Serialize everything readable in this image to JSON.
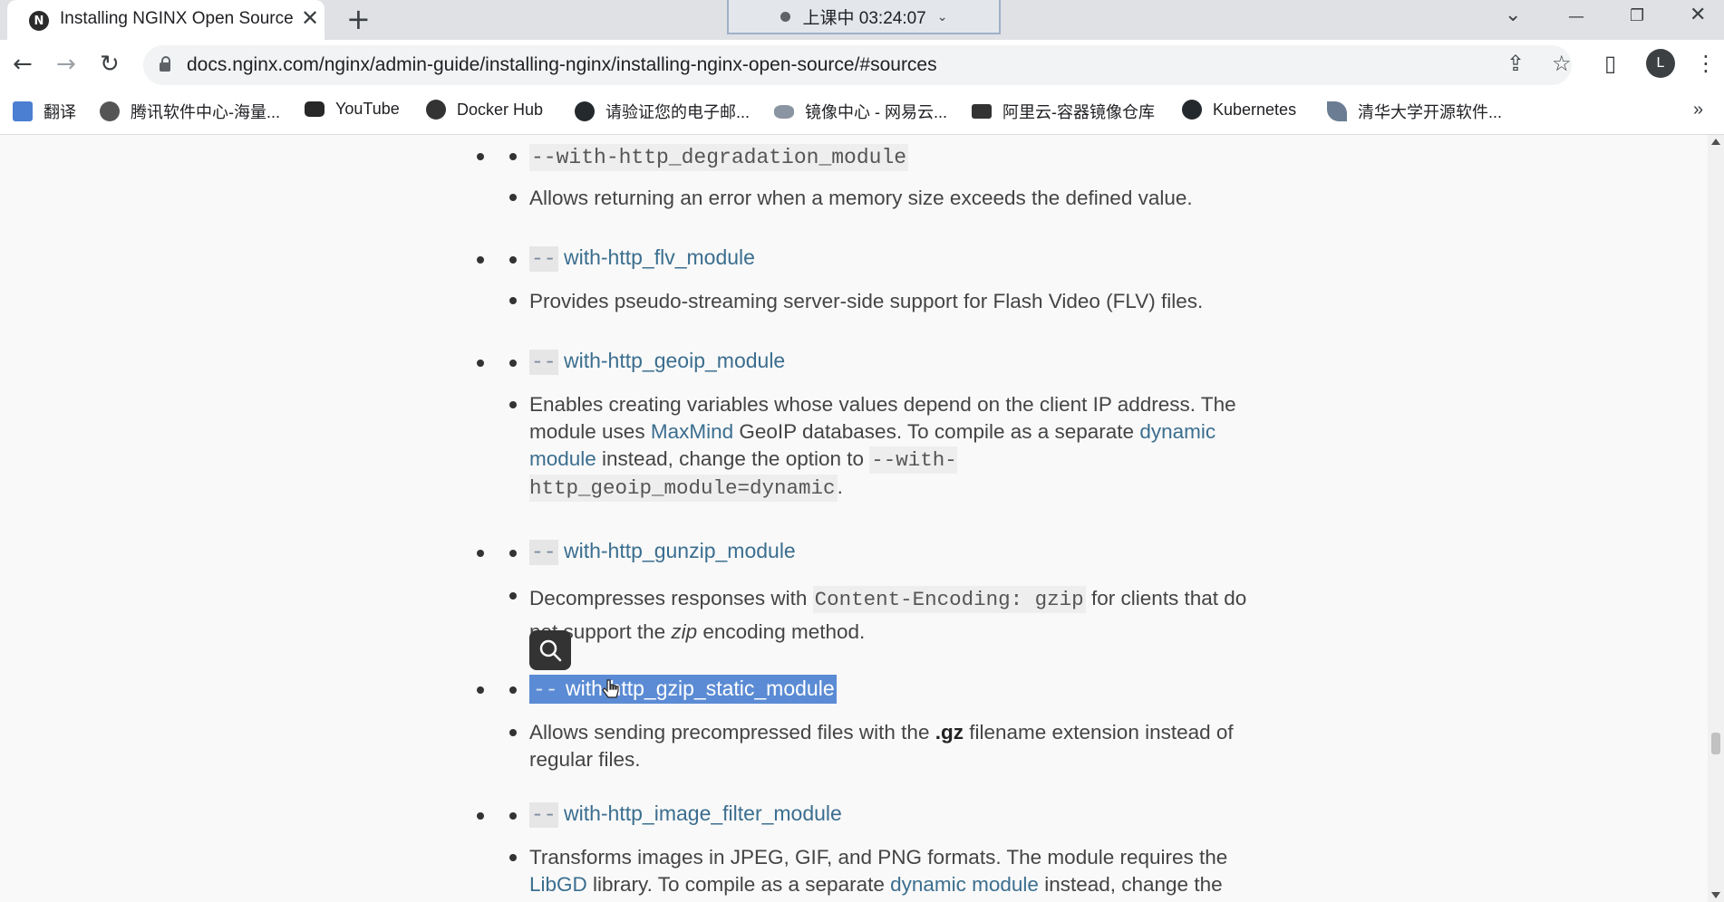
{
  "tab": {
    "favicon": "N",
    "title": "Installing NGINX Open Source",
    "close": "✕"
  },
  "new_tab": "+",
  "clock": {
    "label": "上课中 03:24:07",
    "caret": "⌄"
  },
  "window": {
    "tab_search": "⌄",
    "minimize": "—",
    "restore": "❐",
    "close": "✕"
  },
  "nav": {
    "back": "←",
    "forward": "→",
    "reload": "↻"
  },
  "address": {
    "url": "docs.nginx.com/nginx/admin-guide/installing-nginx/installing-nginx-open-source/#sources"
  },
  "toolbar_icons": {
    "share": "⇪",
    "star": "☆",
    "sidebar": "▯",
    "profile": "L",
    "menu": "⋮"
  },
  "bookmarks": [
    {
      "label": "翻译",
      "icon": "translate-icon",
      "color": "#4a7fd1"
    },
    {
      "label": "腾讯软件中心-海量...",
      "icon": "tencent-icon",
      "color": "#555555"
    },
    {
      "label": "YouTube",
      "icon": "youtube-icon",
      "color": "#282828"
    },
    {
      "label": "Docker Hub",
      "icon": "docker-icon",
      "color": "#333333"
    },
    {
      "label": "请验证您的电子邮...",
      "icon": "github-icon",
      "color": "#24292e"
    },
    {
      "label": "镜像中心 - 网易云...",
      "icon": "netease-cloud-icon",
      "color": "#6b7280"
    },
    {
      "label": "阿里云-容器镜像仓库",
      "icon": "aliyun-icon",
      "color": "#333333"
    },
    {
      "label": "Kubernetes",
      "icon": "github-icon",
      "color": "#24292e"
    },
    {
      "label": "清华大学开源软件...",
      "icon": "tsinghua-icon",
      "color": "#6a7d92"
    }
  ],
  "bookmarks_more": "»",
  "entries": [
    {
      "dash": "--with-http_degradation_module",
      "desc": "Allows returning an error when a memory size exceeds the defined value."
    },
    {
      "dash": "--",
      "name": " with-http_flv_module",
      "desc": "Provides pseudo-streaming server-side support for Flash Video (FLV) files."
    },
    {
      "dash": "--",
      "name": " with-http_geoip_module",
      "desc_parts": {
        "p1": "Enables creating variables whose values depend on the client IP address. The module uses ",
        "link1": "MaxMind",
        "p2": " GeoIP databases. To compile as a separate ",
        "link2": "dynamic module",
        "p3": " instead, change the option to ",
        "code": "--with-http_geoip_module=dynamic",
        "p4": "."
      }
    },
    {
      "dash": "--",
      "name": " with-http_gunzip_module",
      "desc_parts": {
        "p1": "Decompresses responses with ",
        "code": "Content-Encoding: gzip",
        "p2": " for clients that do not support the ",
        "em": "zip",
        "p3": " encoding method."
      }
    },
    {
      "dash": "--",
      "name": " with-http_gzip_static_module",
      "desc_parts": {
        "p1": "Allows sending precompressed files with the ",
        "bold": ".gz",
        "p2": " filename extension instead of regular files."
      }
    },
    {
      "dash": "--",
      "name": " with-http_image_filter_module",
      "desc_parts": {
        "p1": "Transforms images in JPEG, GIF, and PNG formats. The module requires the ",
        "link1": "LibGD",
        "p2": " library. To compile as a separate ",
        "link2": "dynamic module",
        "p3": " instead, change the"
      }
    }
  ]
}
